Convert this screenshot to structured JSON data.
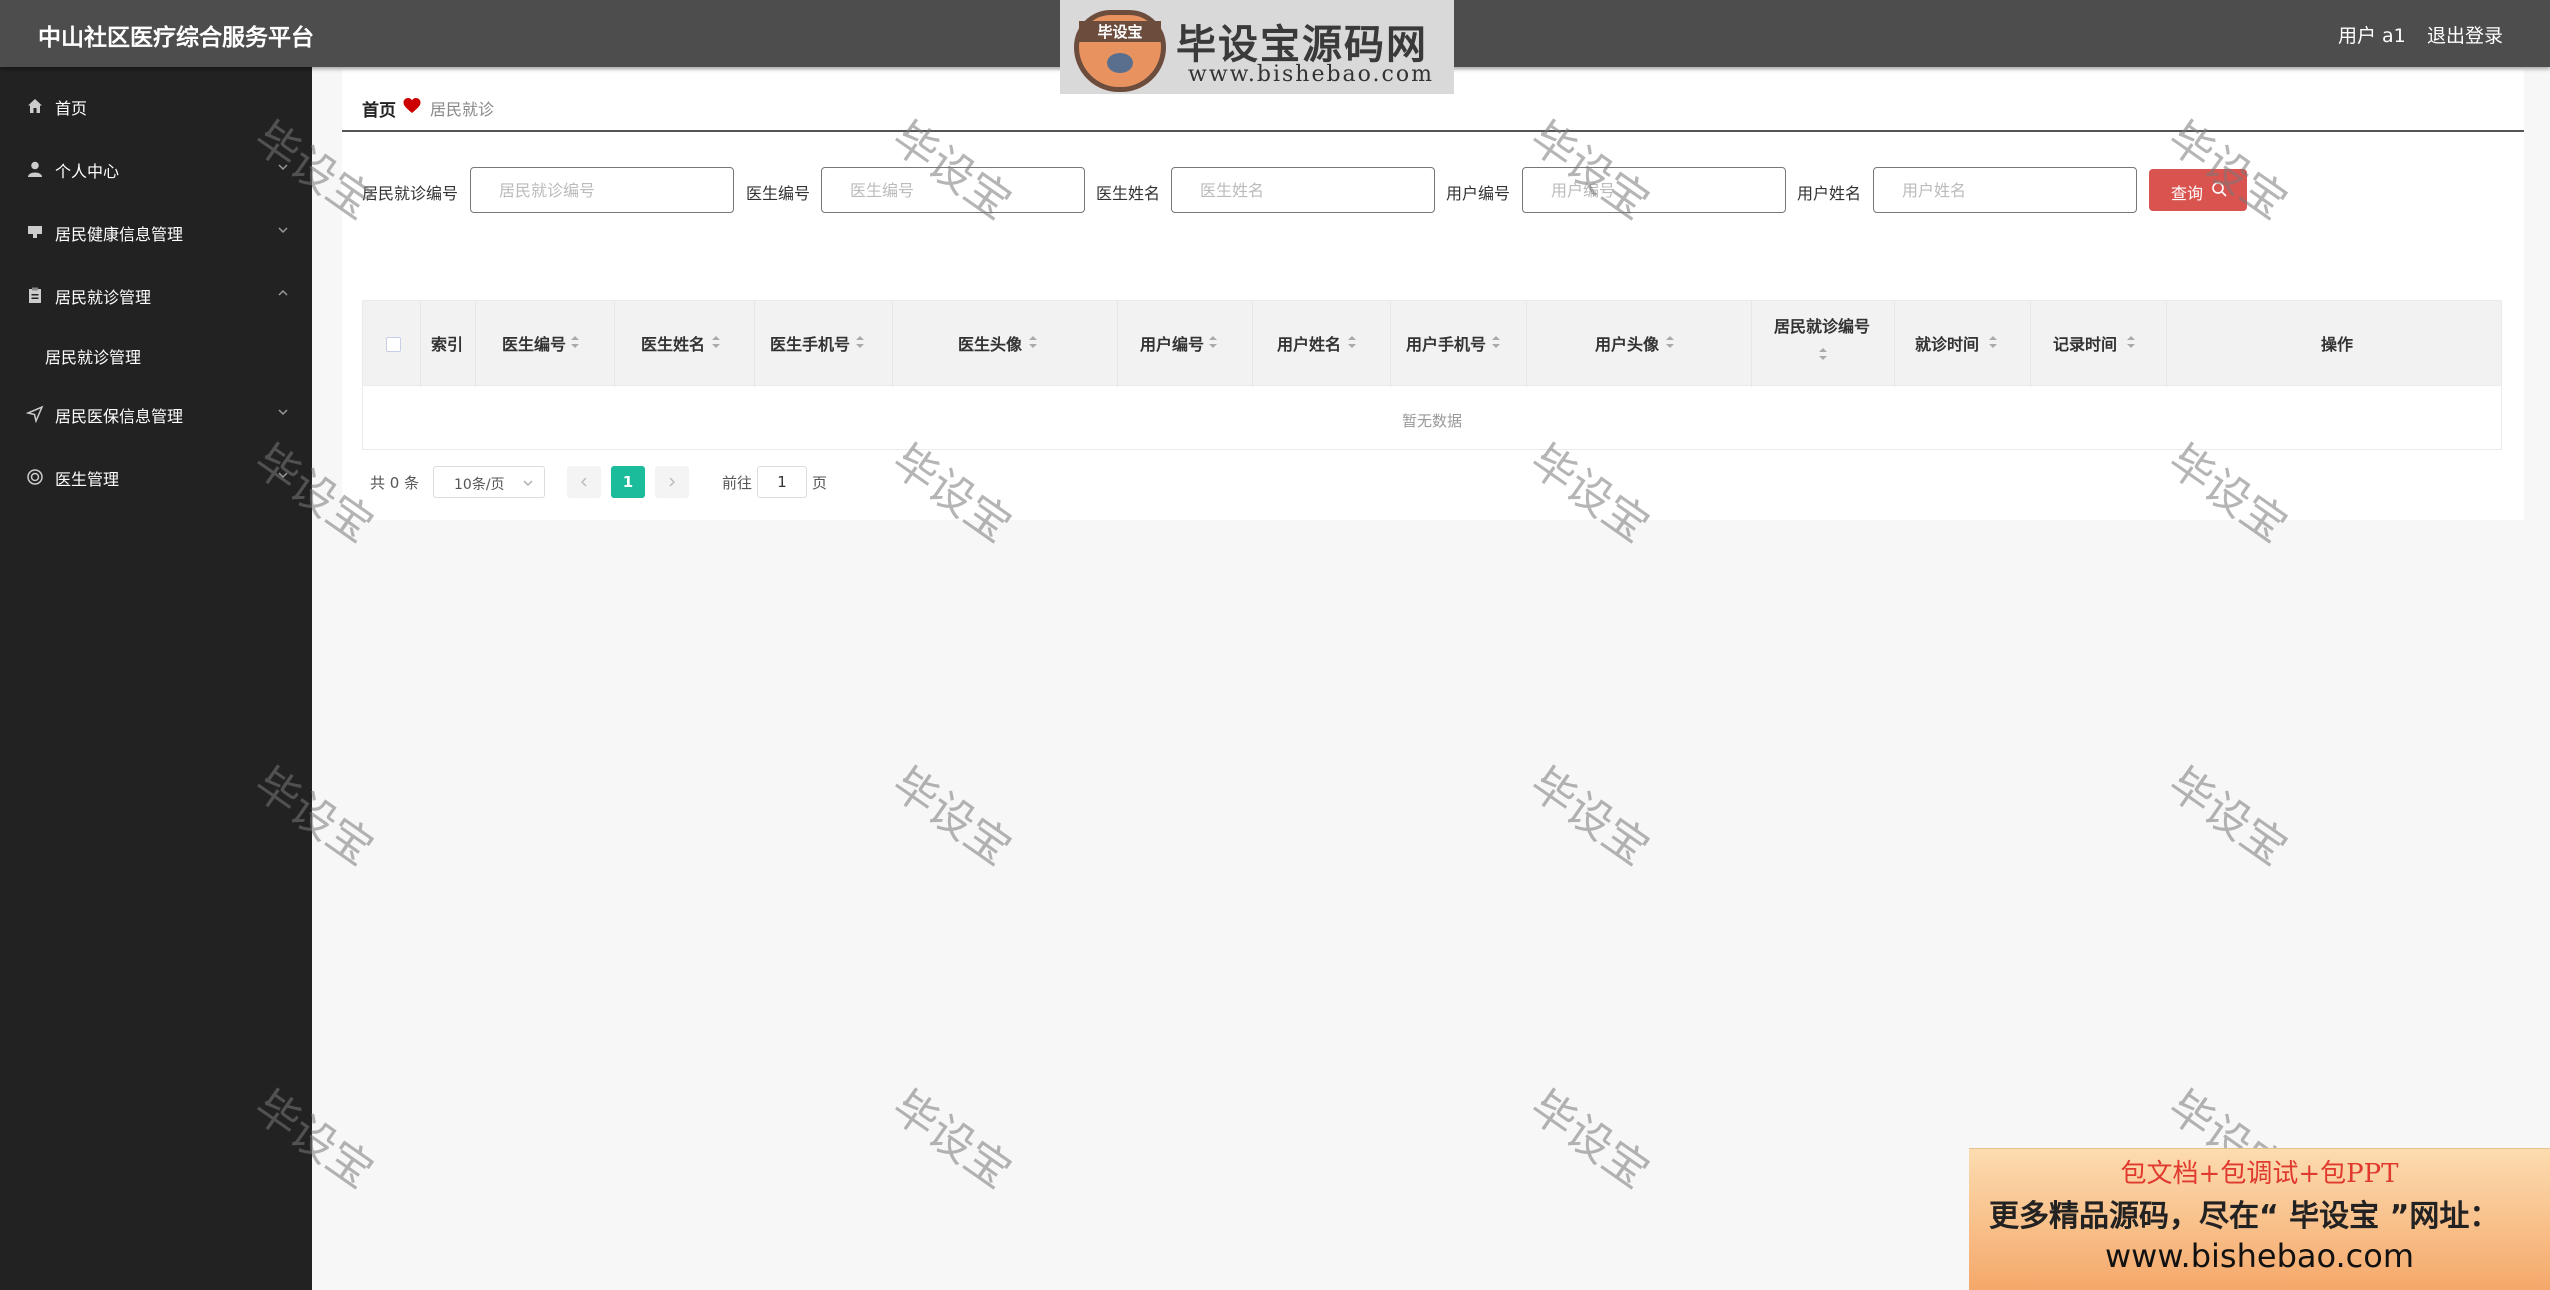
{
  "header": {
    "app_title": "中山社区医疗综合服务平台",
    "user_label": "用户 a1",
    "logout": "退出登录",
    "brand": {
      "badge": "毕设宝",
      "name": "毕设宝源码网",
      "url": "www.bishebao.com"
    }
  },
  "sidebar": {
    "items": [
      {
        "label": "首页",
        "icon": "home-icon"
      },
      {
        "label": "个人中心",
        "icon": "user-icon"
      },
      {
        "label": "居民健康信息管理",
        "icon": "monitor-icon"
      },
      {
        "label": "居民就诊管理",
        "icon": "clipboard-icon",
        "expanded": true
      },
      {
        "label": "居民就诊管理",
        "sub": true
      },
      {
        "label": "居民医保信息管理",
        "icon": "send-icon"
      },
      {
        "label": "医生管理",
        "icon": "target-icon"
      }
    ]
  },
  "breadcrumb": {
    "home": "首页",
    "current": "居民就诊"
  },
  "search": {
    "fields": [
      {
        "label": "居民就诊编号",
        "placeholder": "居民就诊编号"
      },
      {
        "label": "医生编号",
        "placeholder": "医生编号"
      },
      {
        "label": "医生姓名",
        "placeholder": "医生姓名"
      },
      {
        "label": "用户编号",
        "placeholder": "用户编号"
      },
      {
        "label": "用户姓名",
        "placeholder": "用户姓名"
      }
    ],
    "button": "查询"
  },
  "table": {
    "columns": [
      "索引",
      "医生编号",
      "医生姓名",
      "医生手机号",
      "医生头像",
      "用户编号",
      "用户姓名",
      "用户手机号",
      "用户头像",
      "居民就诊编号",
      "就诊时间",
      "记录时间",
      "操作"
    ],
    "empty_text": "暂无数据"
  },
  "pagination": {
    "total": "共 0 条",
    "page_size": "10条/页",
    "current": "1",
    "goto_prefix": "前往",
    "goto_value": "1",
    "goto_suffix": "页"
  },
  "watermark": "毕设宝",
  "promo": {
    "line1": "包文档+包调试+包PPT",
    "line2": "更多精品源码，尽在“ 毕设宝 ”网址：",
    "line3": "www.bishebao.com"
  },
  "colors": {
    "header": "#4d4d4d",
    "sidebar": "#222222",
    "query_button": "#d9534f",
    "pagination_active": "#1abc9c"
  }
}
